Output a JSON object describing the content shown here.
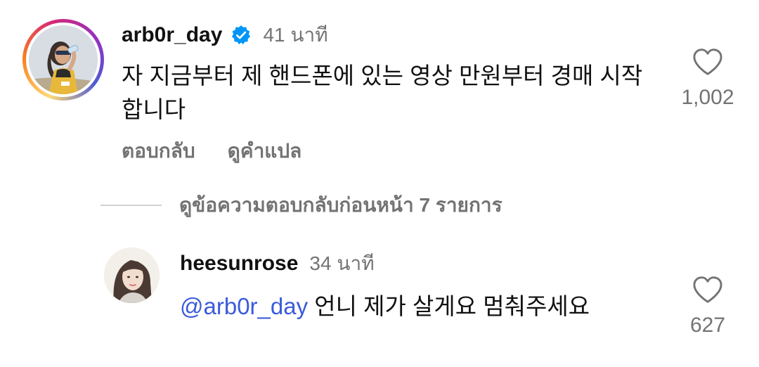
{
  "comments": [
    {
      "username": "arb0r_day",
      "verified": true,
      "time": "41 นาที",
      "text": "자 지금부터 제 핸드폰에 있는 영상 만원부터 경매 시작합니다",
      "likes": "1,002",
      "actions": {
        "reply": "ตอบกลับ",
        "translate": "ดูคำแปล"
      },
      "avatar_story_ring": true
    },
    {
      "username": "heesunrose",
      "verified": false,
      "time": "34 นาที",
      "mention": "@arb0r_day",
      "text": " 언니 제가 살게요 멈춰주세요",
      "likes": "627"
    }
  ],
  "view_replies": "ดูข้อความตอบกลับก่อนหน้า 7 รายการ",
  "colors": {
    "text": "#111111",
    "secondary": "#737373",
    "mention": "#3b5bdb",
    "verified": "#0095f6"
  },
  "icons": {
    "like": "heart-outline-icon",
    "verified": "verified-badge-icon"
  }
}
